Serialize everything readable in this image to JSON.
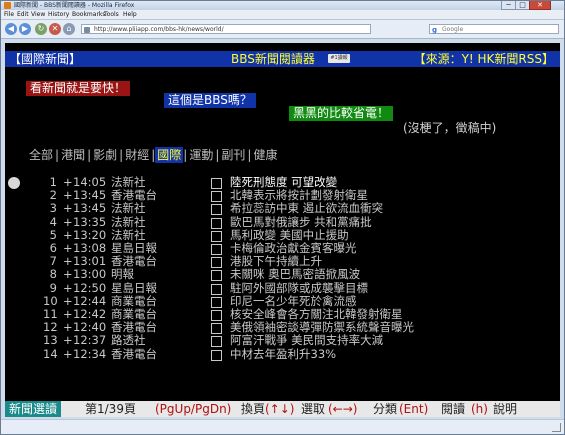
{
  "browser": {
    "window_title": "國際新聞 - BBS新聞閱讀器 - Mozilla Firefox",
    "window_buttons": {
      "minimize": "─",
      "maximize": "□",
      "close": "✕"
    },
    "menu": [
      "File",
      "Edit",
      "View",
      "History",
      "Bookmarks",
      "Tools",
      "Help"
    ],
    "nav_buttons": {
      "back": "◀",
      "forward": "▶",
      "reload": "↻",
      "stop": "✕",
      "home": "⌂"
    },
    "url": "http://www.pliiapp.com/bbs-hk/news/world/",
    "search_placeholder": "Google",
    "search_logo": "g"
  },
  "header": {
    "left": "【國際新聞】",
    "center": "BBS新聞閱讀器",
    "badge": "#1讀報",
    "right": "【來源：Y! HK新聞RSS】"
  },
  "banners": [
    "看新聞就是要快！",
    "這個是BBS嗎？",
    "黑黑的比較省電！"
  ],
  "aside": "(沒梗了，徵稿中)",
  "tabs": [
    "全部",
    "港聞",
    "影劇",
    "財經",
    "國際",
    "運動",
    "副刊",
    "健康"
  ],
  "active_tab": "國際",
  "tab_separator": "|",
  "news": [
    {
      "num": "1",
      "plus": "+",
      "time": "14:05",
      "source": "法新社",
      "title": "陸死刑態度 可望改變"
    },
    {
      "num": "2",
      "plus": "+",
      "time": "13:45",
      "source": "香港電台",
      "title": "北韓表示將按計劃發射衛星"
    },
    {
      "num": "3",
      "plus": "+",
      "time": "13:45",
      "source": "法新社",
      "title": "希拉蕊訪中東 遏止欲流血衝突"
    },
    {
      "num": "4",
      "plus": "+",
      "time": "13:35",
      "source": "法新社",
      "title": "歐巴馬對俄讓步 共和黨痛批"
    },
    {
      "num": "5",
      "plus": "+",
      "time": "13:20",
      "source": "法新社",
      "title": "馬利政變 美國中止援助"
    },
    {
      "num": "6",
      "plus": "+",
      "time": "13:08",
      "source": "星島日報",
      "title": "卡梅倫政治獻金賓客曝光"
    },
    {
      "num": "7",
      "plus": "+",
      "time": "13:01",
      "source": "香港電台",
      "title": "港股下午持續上升"
    },
    {
      "num": "8",
      "plus": "+",
      "time": "13:00",
      "source": "明報",
      "title": "未關咪 奧巴馬密語掀風波"
    },
    {
      "num": "9",
      "plus": "+",
      "time": "12:50",
      "source": "星島日報",
      "title": "駐阿外國部隊或成襲擊目標"
    },
    {
      "num": "10",
      "plus": "+",
      "time": "12:44",
      "source": "商業電台",
      "title": "印尼一名少年死於禽流感"
    },
    {
      "num": "11",
      "plus": "+",
      "time": "12:42",
      "source": "商業電台",
      "title": "核安全峰會各方關注北韓發射衛星"
    },
    {
      "num": "12",
      "plus": "+",
      "time": "12:40",
      "source": "香港電台",
      "title": "美俄領袖密談導彈防禦系統聲音曝光"
    },
    {
      "num": "13",
      "plus": "+",
      "time": "12:37",
      "source": "路透社",
      "title": "阿富汗戰爭 美民間支持率大減"
    },
    {
      "num": "14",
      "plus": "+",
      "time": "12:34",
      "source": "香港電台",
      "title": "中材去年盈利升33%"
    }
  ],
  "footer": {
    "mode": "新聞選讀",
    "page": "第1/39頁",
    "key_page": "(PgUp/PgDn)",
    "act_page": "換頁",
    "key_select": "(↑↓)",
    "act_select": "選取",
    "key_category": "(←→)",
    "act_category": "分類",
    "key_read": "(Ent)",
    "act_read": "閱讀",
    "key_help": "(h)",
    "act_help": "說明"
  }
}
